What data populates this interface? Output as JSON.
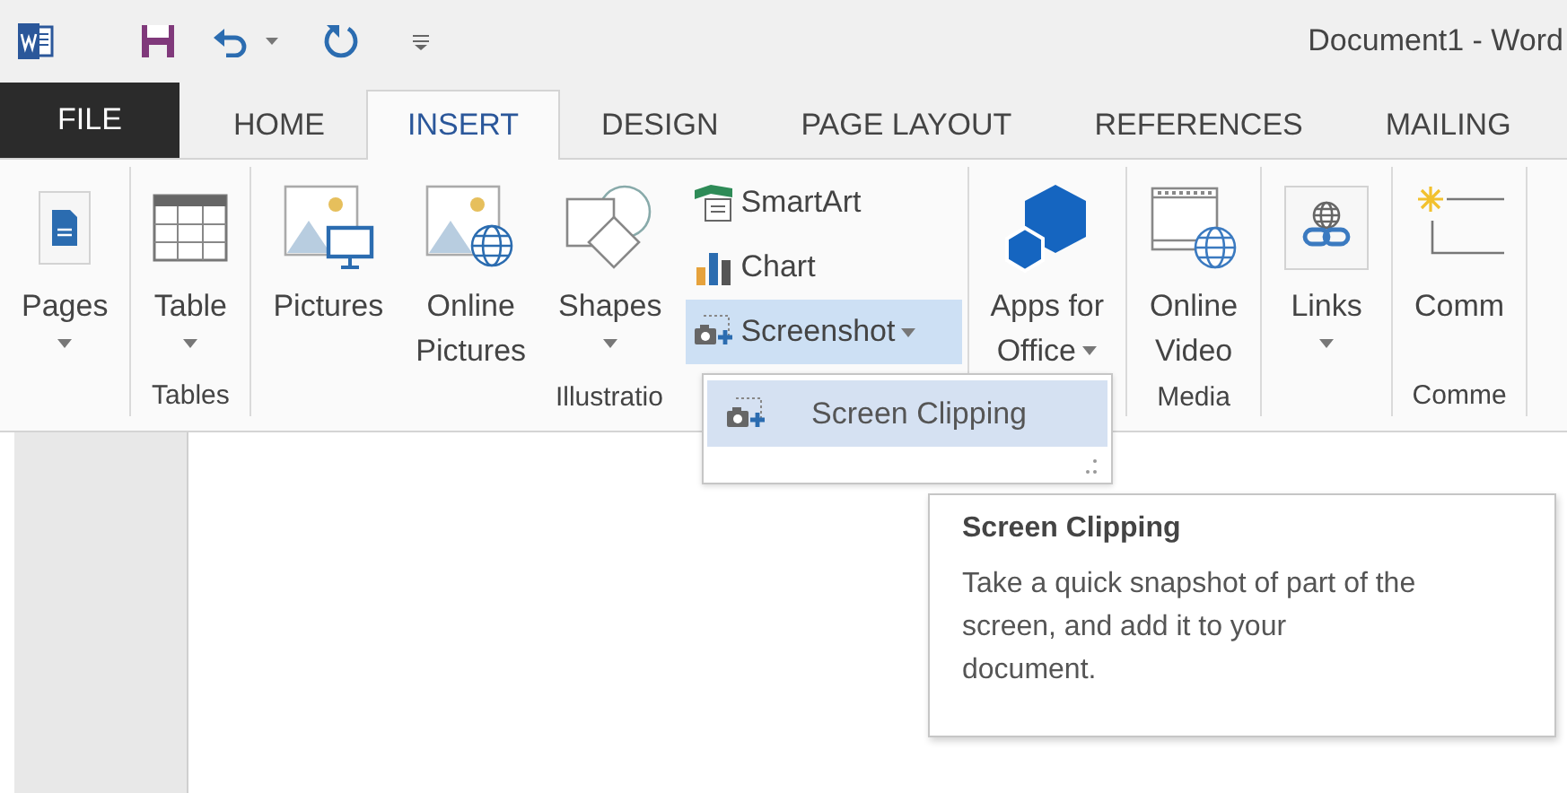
{
  "window": {
    "title": "Document1 - Word"
  },
  "tabs": [
    {
      "label": "FILE",
      "kind": "file",
      "selected": false
    },
    {
      "label": "HOME",
      "kind": "tab",
      "selected": false
    },
    {
      "label": "INSERT",
      "kind": "tab",
      "selected": true
    },
    {
      "label": "DESIGN",
      "kind": "tab",
      "selected": false
    },
    {
      "label": "PAGE LAYOUT",
      "kind": "tab",
      "selected": false
    },
    {
      "label": "REFERENCES",
      "kind": "tab",
      "selected": false
    },
    {
      "label": "MAILING",
      "kind": "tab",
      "selected": false
    }
  ],
  "ribbon": {
    "groups": [
      {
        "items": [
          {
            "kind": "large",
            "lines": [
              "Pages"
            ],
            "dropdown": true
          }
        ]
      },
      {
        "label": "Tables",
        "items": [
          {
            "kind": "large",
            "lines": [
              "Table"
            ],
            "dropdown": true
          }
        ]
      },
      {
        "label": "Illustratio",
        "items": [
          {
            "kind": "large",
            "lines": [
              "Pictures"
            ],
            "dropdown": false
          },
          {
            "kind": "large",
            "lines": [
              "Online",
              "Pictures"
            ],
            "dropdown": false
          },
          {
            "kind": "large",
            "lines": [
              "Shapes"
            ],
            "dropdown": true
          },
          {
            "kind": "stack",
            "items": [
              {
                "label": "SmartArt",
                "dropdown": false,
                "open": false
              },
              {
                "label": "Chart",
                "dropdown": false,
                "open": false
              },
              {
                "label": "Screenshot",
                "dropdown": true,
                "open": true
              }
            ]
          }
        ]
      },
      {
        "items": [
          {
            "kind": "large",
            "lines": [
              "Apps for",
              "Office"
            ],
            "dropdown": true
          }
        ]
      },
      {
        "label": "Media",
        "items": [
          {
            "kind": "large",
            "lines": [
              "Online",
              "Video"
            ],
            "dropdown": false
          }
        ]
      },
      {
        "items": [
          {
            "kind": "large",
            "lines": [
              "Links"
            ],
            "dropdown": true
          }
        ]
      },
      {
        "label": "Comme",
        "items": [
          {
            "kind": "large",
            "lines": [
              "Comm"
            ],
            "dropdown": false
          }
        ]
      }
    ]
  },
  "menu": {
    "items": [
      {
        "label": "Screen Clipping",
        "highlighted": true
      }
    ]
  },
  "tooltip": {
    "title": "Screen Clipping",
    "text": "Take a quick snapshot of part of the screen, and add it to your document."
  }
}
